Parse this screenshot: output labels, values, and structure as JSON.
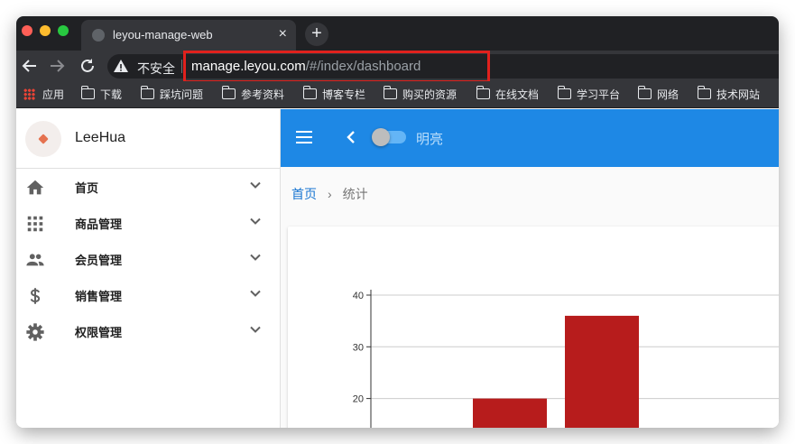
{
  "browser": {
    "tab_title": "leyou-manage-web",
    "tab_close": "×",
    "new_tab": "+",
    "security_label": "不安全",
    "url_host": "manage.leyou.com",
    "url_path": "/#/index/dashboard",
    "bookmarks": [
      "应用",
      "下载",
      "踩坑问题",
      "参考资料",
      "博客专栏",
      "购买的资源",
      "在线文档",
      "学习平台",
      "网络",
      "技术网站"
    ]
  },
  "sidebar": {
    "username": "LeeHua",
    "items": [
      {
        "label": "首页",
        "icon": "home-icon"
      },
      {
        "label": "商品管理",
        "icon": "apps-grid-icon"
      },
      {
        "label": "会员管理",
        "icon": "people-icon"
      },
      {
        "label": "销售管理",
        "icon": "dollar-icon"
      },
      {
        "label": "权限管理",
        "icon": "gear-icon"
      }
    ]
  },
  "appbar": {
    "theme_label": "明亮",
    "theme_switch_on": false
  },
  "breadcrumb": {
    "home": "首页",
    "separator": "›",
    "current": "统计"
  },
  "colors": {
    "appbar": "#1e88e5",
    "bar": "#b71c1c",
    "highlight": "#e0211d"
  },
  "chart_data": {
    "type": "bar",
    "values": [
      20,
      36
    ],
    "yticks": [
      "20",
      "30",
      "40"
    ],
    "ylim": [
      10,
      40
    ],
    "grid": true
  }
}
